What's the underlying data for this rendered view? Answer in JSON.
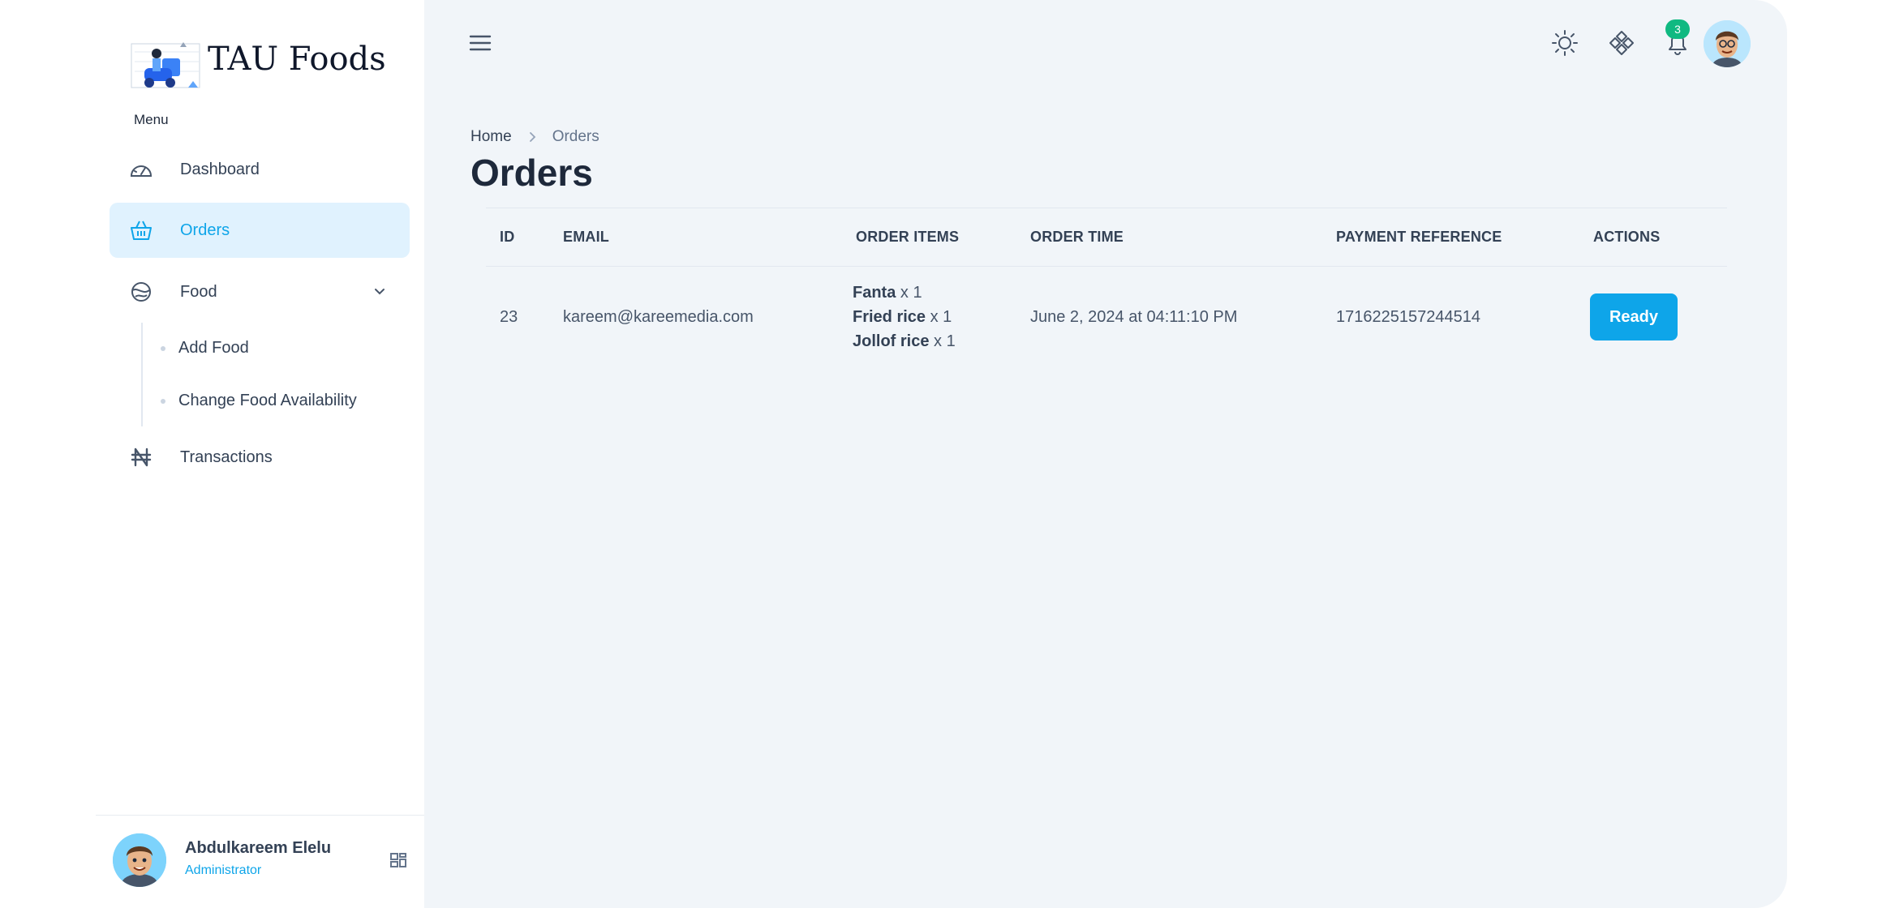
{
  "brand": {
    "name": "TAU Foods"
  },
  "sidebar": {
    "menu_label": "Menu",
    "items": [
      {
        "label": "Dashboard",
        "icon": "speedometer-icon"
      },
      {
        "label": "Orders",
        "icon": "basket-icon",
        "active": true
      },
      {
        "label": "Food",
        "icon": "food-bowl-icon",
        "expanded": true,
        "children": [
          {
            "label": "Add Food"
          },
          {
            "label": "Change Food Availability"
          }
        ]
      },
      {
        "label": "Transactions",
        "icon": "naira-icon"
      }
    ]
  },
  "user": {
    "name": "Abdulkareem Elelu",
    "role": "Administrator"
  },
  "header": {
    "notifications_count": "3"
  },
  "breadcrumb": {
    "home": "Home",
    "current": "Orders"
  },
  "page": {
    "title": "Orders"
  },
  "table": {
    "columns": [
      "ID",
      "EMAIL",
      "ORDER ITEMS",
      "ORDER TIME",
      "PAYMENT REFERENCE",
      "ACTIONS"
    ],
    "rows": [
      {
        "id": "23",
        "email": "kareem@kareemedia.com",
        "items": [
          {
            "name": "Fanta",
            "qty": "x 1"
          },
          {
            "name": "Fried rice",
            "qty": "x 1"
          },
          {
            "name": "Jollof rice",
            "qty": "x 1"
          }
        ],
        "order_time": "June 2, 2024 at 04:11:10 PM",
        "payment_reference": "1716225157244514",
        "action_label": "Ready"
      }
    ]
  },
  "colors": {
    "accent": "#0ea5e9",
    "active_bg": "#e0f2fe",
    "badge": "#10b981",
    "main_bg": "#f1f5f9"
  }
}
